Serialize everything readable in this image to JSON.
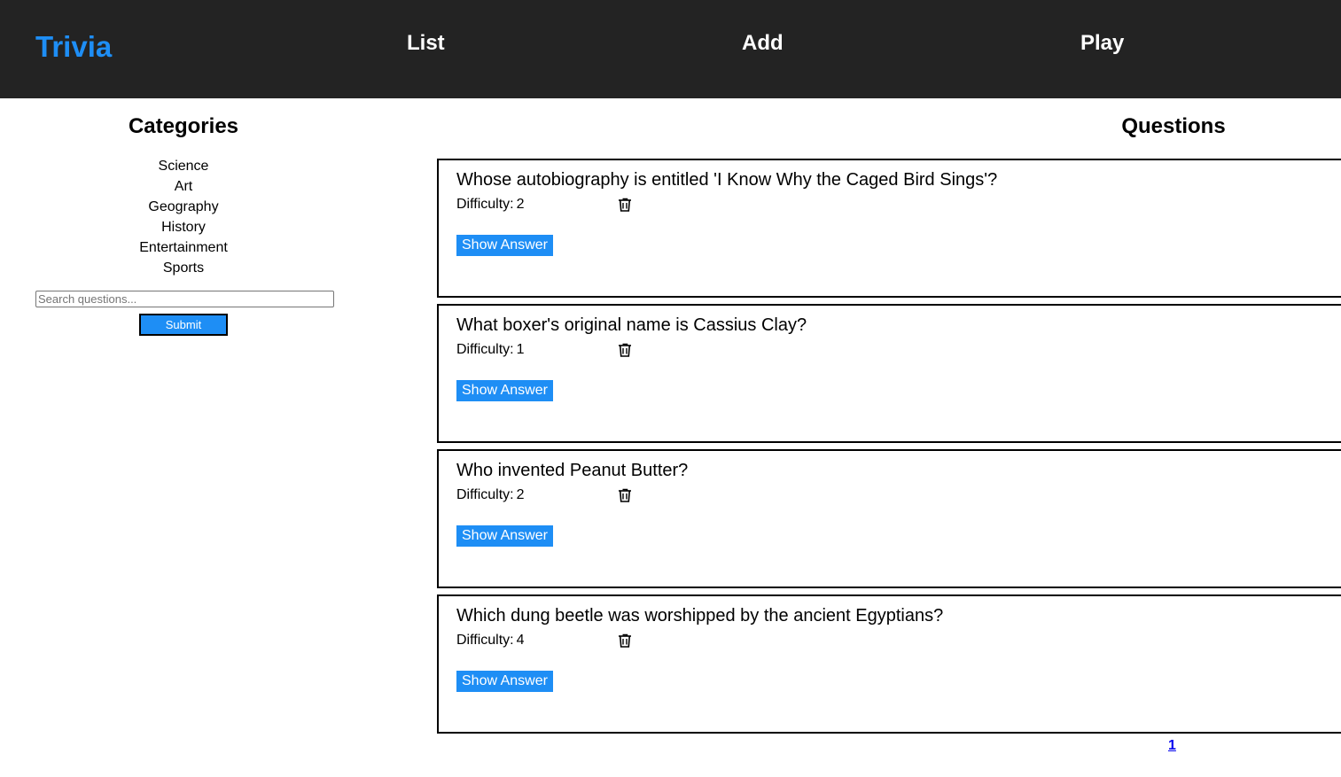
{
  "header": {
    "logo": "Trivia",
    "nav": {
      "list": "List",
      "add": "Add",
      "play": "Play"
    },
    "background_color": "#232323",
    "logo_color": "#1e8ef5"
  },
  "sidebar": {
    "title": "Categories",
    "categories": [
      "Science",
      "Art",
      "Geography",
      "History",
      "Entertainment",
      "Sports"
    ],
    "search": {
      "placeholder": "Search questions...",
      "value": ""
    },
    "submit_label": "Submit"
  },
  "main": {
    "title": "Questions",
    "questions": [
      {
        "question": "Whose autobiography is entitled 'I Know Why the Caged Bird Sings'?",
        "difficulty_label": "Difficulty:",
        "difficulty": "2",
        "show_answer_label": "Show Answer",
        "delete_icon": "trash-icon"
      },
      {
        "question": "What boxer's original name is Cassius Clay?",
        "difficulty_label": "Difficulty:",
        "difficulty": "1",
        "show_answer_label": "Show Answer",
        "delete_icon": "trash-icon"
      },
      {
        "question": "Who invented Peanut Butter?",
        "difficulty_label": "Difficulty:",
        "difficulty": "2",
        "show_answer_label": "Show Answer",
        "delete_icon": "trash-icon"
      },
      {
        "question": "Which dung beetle was worshipped by the ancient Egyptians?",
        "difficulty_label": "Difficulty:",
        "difficulty": "4",
        "show_answer_label": "Show Answer",
        "delete_icon": "trash-icon"
      }
    ],
    "pagination": {
      "pages": [
        "1"
      ]
    }
  },
  "colors": {
    "accent": "#1e8ef5",
    "header_bg": "#232323",
    "link": "#0000ee"
  }
}
